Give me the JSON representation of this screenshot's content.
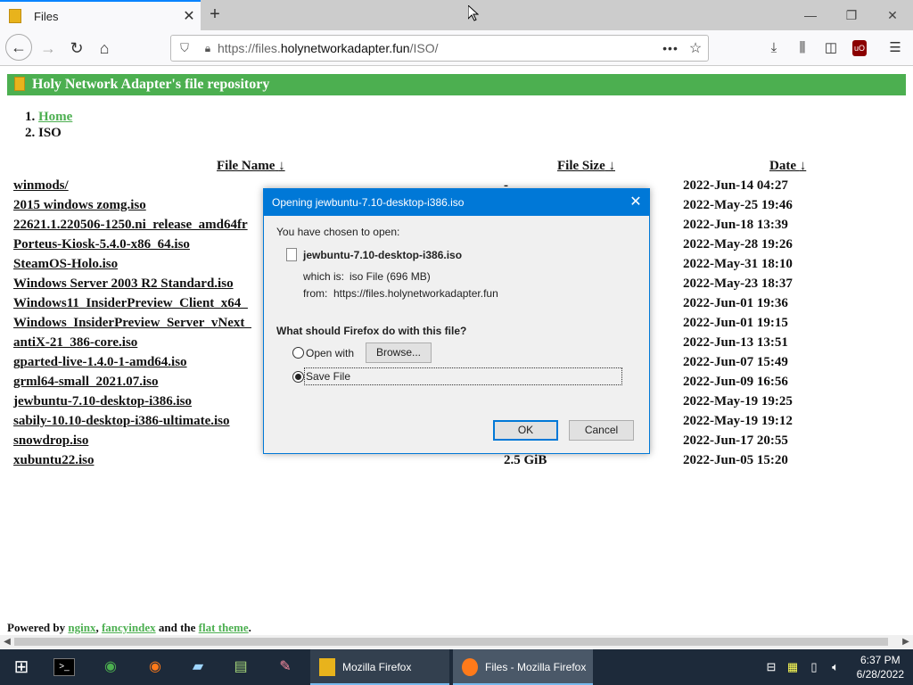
{
  "browser": {
    "tab_title": "Files",
    "new_tab_icon": "+",
    "close_tab_icon": "✕",
    "url_prefix": "https://files.",
    "url_domain": "holynetworkadapter.fun",
    "url_path": "/ISO/"
  },
  "page": {
    "header": "Holy Network Adapter's file repository",
    "breadcrumbs": [
      {
        "num": "1.",
        "label": "Home"
      },
      {
        "num": "2.",
        "label": "ISO"
      }
    ],
    "columns": {
      "name": "File Name",
      "size": "File Size",
      "date": "Date",
      "sort_arrow": "↓"
    },
    "files": [
      {
        "name": "winmods/",
        "size": "-",
        "date": "2022-Jun-14 04:27"
      },
      {
        "name": "2015 windows zomg.iso",
        "size": "",
        "date": "2022-May-25 19:46"
      },
      {
        "name": "22621.1.220506-1250.ni_release_amd64fr",
        "size": "",
        "date": "2022-Jun-18 13:39"
      },
      {
        "name": "Porteus-Kiosk-5.4.0-x86_64.iso",
        "size": "",
        "date": "2022-May-28 19:26"
      },
      {
        "name": "SteamOS-Holo.iso",
        "size": "",
        "date": "2022-May-31 18:10"
      },
      {
        "name": "Windows Server 2003 R2 Standard.iso",
        "size": "",
        "date": "2022-May-23 18:37"
      },
      {
        "name": "Windows11_InsiderPreview_Client_x64_",
        "size": "",
        "date": "2022-Jun-01 19:36"
      },
      {
        "name": "Windows_InsiderPreview_Server_vNext_",
        "size": "",
        "date": "2022-Jun-01 19:15"
      },
      {
        "name": "antiX-21_386-core.iso",
        "size": "",
        "date": "2022-Jun-13 13:51"
      },
      {
        "name": "gparted-live-1.4.0-1-amd64.iso",
        "size": "",
        "date": "2022-Jun-07 15:49"
      },
      {
        "name": "grml64-small_2021.07.iso",
        "size": "",
        "date": "2022-Jun-09 16:56"
      },
      {
        "name": "jewbuntu-7.10-desktop-i386.iso",
        "size": "",
        "date": "2022-May-19 19:25"
      },
      {
        "name": "sabily-10.10-desktop-i386-ultimate.iso",
        "size": "",
        "date": "2022-May-19 19:12"
      },
      {
        "name": "snowdrop.iso",
        "size": "",
        "date": "2022-Jun-17 20:55"
      },
      {
        "name": "xubuntu22.iso",
        "size": "2.5 GiB",
        "date": "2022-Jun-05 15:20"
      }
    ],
    "footer": {
      "prefix": "Powered by ",
      "link1": "nginx",
      "sep": ", ",
      "link2": "fancyindex",
      "mid": " and the ",
      "link3": "flat theme",
      "end": "."
    }
  },
  "dialog": {
    "title": "Opening jewbuntu-7.10-desktop-i386.iso",
    "chosen": "You have chosen to open:",
    "filename": "jewbuntu-7.10-desktop-i386.iso",
    "which_is_label": "which is:",
    "which_is_value": "iso File (696 MB)",
    "from_label": "from:",
    "from_value": "https://files.holynetworkadapter.fun",
    "question": "What should Firefox do with this file?",
    "open_with": "Open with",
    "browse": "Browse...",
    "save_file": "Save File",
    "ok": "OK",
    "cancel": "Cancel",
    "selected_option": "save_file"
  },
  "taskbar": {
    "tasks": [
      {
        "label": "Mozilla Firefox"
      },
      {
        "label": "Files - Mozilla Firefox"
      }
    ],
    "time": "6:37 PM",
    "date": "6/28/2022"
  },
  "colors": {
    "accent_green": "#4caf50",
    "dialog_blue": "#0078d7",
    "taskbar": "#1d2a3a"
  }
}
